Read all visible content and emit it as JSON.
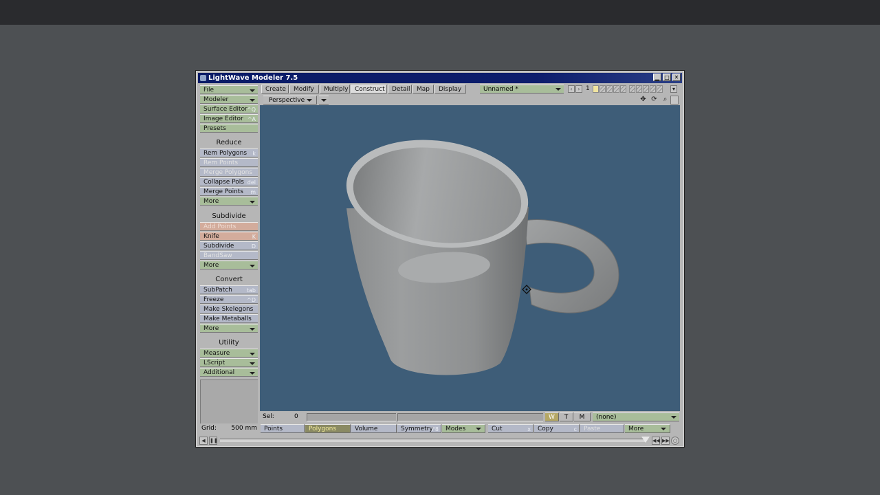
{
  "window": {
    "title": "LightWave Modeler 7.5"
  },
  "left_panel": {
    "file": "File",
    "modeler": "Modeler",
    "surface_editor": {
      "label": "Surface Editor",
      "key": "^Q"
    },
    "image_editor": {
      "label": "Image Editor",
      "key": "^A"
    },
    "presets": "Presets",
    "reduce": {
      "heading": "Reduce",
      "rem_polygons": {
        "label": "Rem Polygons",
        "key": "k"
      },
      "rem_points": "Rem Points",
      "merge_polygons": "Merge Polygons",
      "collapse_pols": {
        "label": "Collapse Pols",
        "key": "del"
      },
      "merge_points": {
        "label": "Merge Points",
        "key": "m"
      },
      "more": "More"
    },
    "subdivide": {
      "heading": "Subdivide",
      "add_points": "Add Points",
      "knife": {
        "label": "Knife",
        "key": "K"
      },
      "subdivide": {
        "label": "Subdivide",
        "key": "D"
      },
      "bandsaw": "BandSaw",
      "more": "More"
    },
    "convert": {
      "heading": "Convert",
      "subpatch": {
        "label": "SubPatch",
        "key": "tab"
      },
      "freeze": {
        "label": "Freeze",
        "key": "^D"
      },
      "make_skelegons": "Make Skelegons",
      "make_metaballs": "Make Metaballs",
      "more": "More"
    },
    "utility": {
      "heading": "Utility",
      "measure": "Measure",
      "lscript": "LScript",
      "additional": "Additional"
    }
  },
  "tabs": [
    "Create",
    "Modify",
    "Multiply",
    "Construct",
    "Detail",
    "Map",
    "Display"
  ],
  "active_tab": "Construct",
  "layer_select": "Unnamed *",
  "layer_number": "1",
  "viewport": {
    "view": "Perspective"
  },
  "status": {
    "sel_label": "Sel:",
    "sel_value": "0",
    "w": "W",
    "t": "T",
    "m": "M",
    "surface": "(none)"
  },
  "bottom": {
    "grid_label": "Grid:",
    "grid_value": "500 mm",
    "points": "Points",
    "polygons": "Polygons",
    "volume": "Volume",
    "symmetry": {
      "label": "Symmetry",
      "key": "F8"
    },
    "modes": "Modes",
    "cut": {
      "label": "Cut",
      "key": "x"
    },
    "copy": {
      "label": "Copy",
      "key": "c"
    },
    "paste": "Paste",
    "more": "More"
  },
  "colors": {
    "viewport_bg": "#3e5d78",
    "menu_green": "#a8bd9a",
    "command_blue": "#b4b9c8",
    "hot_salmon": "#d3ac9c",
    "titlebar": "#0a1b66"
  }
}
